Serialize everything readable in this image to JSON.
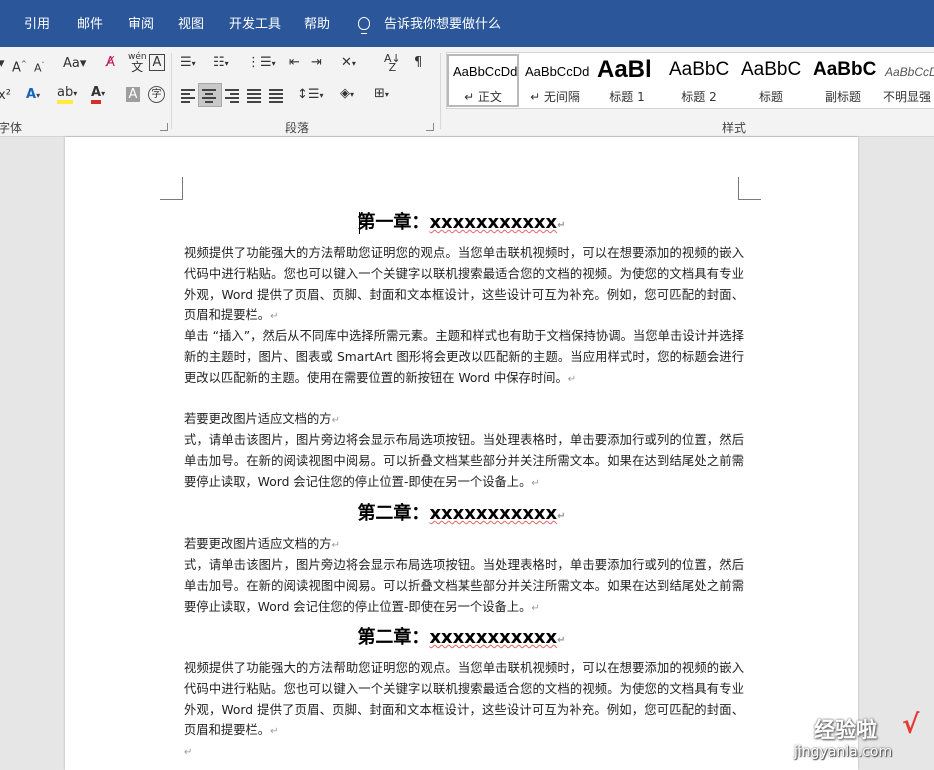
{
  "ribbon_tabs": [
    "引用",
    "邮件",
    "审阅",
    "视图",
    "开发工具",
    "帮助"
  ],
  "tell_me": "告诉我你想要做什么",
  "groups": {
    "font": "字体",
    "paragraph": "段落",
    "styles": "样式"
  },
  "styles": [
    {
      "preview": "AaBbCcDd",
      "name": "↵ 正文"
    },
    {
      "preview": "AaBbCcDd",
      "name": "↵ 无间隔"
    },
    {
      "preview": "AaBl",
      "name": "标题 1"
    },
    {
      "preview": "AaBbC",
      "name": "标题 2"
    },
    {
      "preview": "AaBbC",
      "name": "标题"
    },
    {
      "preview": "AaBbC",
      "name": "副标题"
    },
    {
      "preview": "AaBbCcDd",
      "name": "不明显强"
    }
  ],
  "document": {
    "heading1": {
      "label": "第一章：",
      "xs": "xxxxxxxxxxx"
    },
    "p1": "视频提供了功能强大的方法帮助您证明您的观点。当您单击联机视频时，可以在想要添加的视频的嵌入代码中进行粘贴。您也可以键入一个关键字以联机搜索最适合您的文档的视频。为使您的文档具有专业外观，Word 提供了页眉、页脚、封面和文本框设计，这些设计可互为补充。例如，您可匹配的封面、页眉和提要栏。",
    "p2": "单击 “插入”，然后从不同库中选择所需元素。主题和样式也有助于文档保持协调。当您单击设计并选择新的主题时，图片、图表或 SmartArt 图形将会更改以匹配新的主题。当应用样式时，您的标题会进行更改以匹配新的主题。使用在需要位置的新按钮在 Word 中保存时间。",
    "p3a": "若要更改图片适应文档的方",
    "p3b": "式，请单击该图片，图片旁边将会显示布局选项按钮。当处理表格时，单击要添加行或列的位置，然后单击加号。在新的阅读视图中阅易。可以折叠文档某些部分并关注所需文本。如果在达到结尾处之前需要停止读取，Word 会记住您的停止位置-即使在另一个设备上。",
    "heading2": {
      "label": "第二章：",
      "xs": "xxxxxxxxxxx"
    },
    "p4a": "若要更改图片适应文档的方",
    "p4b": "式，请单击该图片，图片旁边将会显示布局选项按钮。当处理表格时，单击要添加行或列的位置，然后单击加号。在新的阅读视图中阅易。可以折叠文档某些部分并关注所需文本。如果在达到结尾处之前需要停止读取，Word 会记住您的停止位置-即使在另一个设备上。",
    "heading3": {
      "label": "第二章：",
      "xs": "xxxxxxxxxxx"
    },
    "p5": "视频提供了功能强大的方法帮助您证明您的观点。当您单击联机视频时，可以在想要添加的视频的嵌入代码中进行粘贴。您也可以键入一个关键字以联机搜索最适合您的文档的视频。为使您的文档具有专业外观，Word 提供了页眉、页脚、封面和文本框设计，这些设计可互为补充。例如，您可匹配的封面、页眉和提要栏。",
    "para_mark": "↵"
  },
  "watermark": {
    "main": "经验啦",
    "check": "√",
    "sub": "jingyanla.com"
  },
  "colors": {
    "ribbon_blue": "#2b579a",
    "font_red": "#d32f2f",
    "highlight_yellow": "#ffeb3b"
  }
}
